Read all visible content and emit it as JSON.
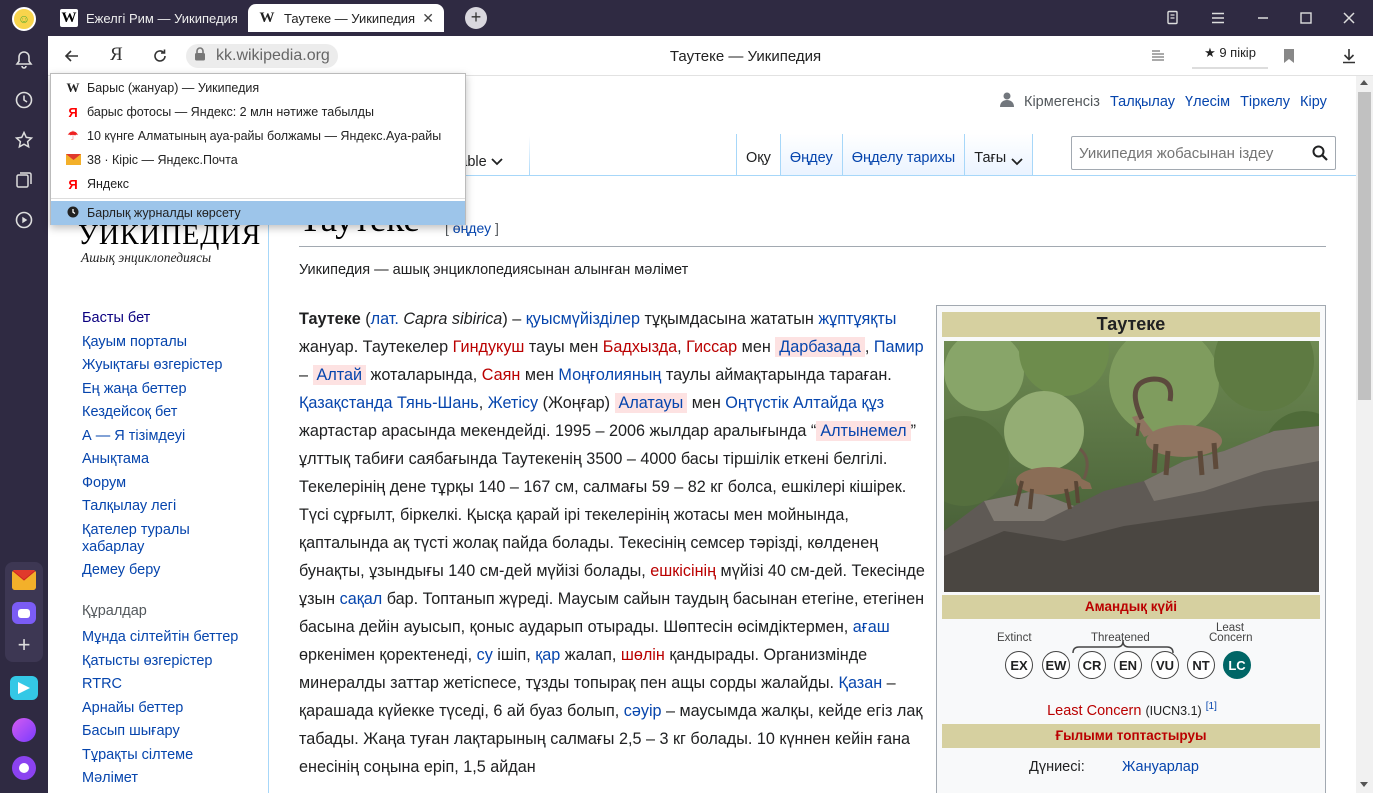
{
  "tabs": [
    {
      "title": "Ежелгі Рим — Уикипедия",
      "favicon": "W",
      "active": false
    },
    {
      "title": "Таутеке — Уикипедия",
      "favicon": "W",
      "active": true
    }
  ],
  "address": {
    "url": "kk.wikipedia.org",
    "page_title": "Таутеке — Уикипедия",
    "reviews": "9 пікір",
    "ya_letter": "Я"
  },
  "history_dropdown": {
    "items": [
      {
        "icon": "wikipedia-favicon",
        "glyph": "W",
        "label": "Барыс (жануар) — Уикипедия"
      },
      {
        "icon": "yandex-favicon",
        "glyph": "Я",
        "label": "барыс фотосы — Яндекс: 2 млн нәтиже табылды"
      },
      {
        "icon": "weather-umbrella-icon",
        "glyph": "☂",
        "label": "10 күнге Алматының ауа-райы болжамы — Яндекс.Ауа-райы"
      },
      {
        "icon": "mail-envelope-icon",
        "glyph": "✉",
        "label": "38 · Кіріс — Яндекс.Почта"
      },
      {
        "icon": "yandex-favicon",
        "glyph": "Я",
        "label": "Яндекс"
      }
    ],
    "show_all": "Барлық журналды көрсету"
  },
  "wiki": {
    "personal": [
      "Кірмегенсіз",
      "Талқылау",
      "Үлесім",
      "Тіркелу",
      "Кіру"
    ],
    "views": {
      "read": "Оқу",
      "edit": "Өңдеу",
      "history": "Өңделу тарихы",
      "more": "Тағы",
      "variant": "sable"
    },
    "search_placeholder": "Уикипедия жобасынан іздеу",
    "logo_title": "УИКИПЕДИЯ",
    "logo_sub": "Ашық энциклопедиясы",
    "nav": [
      "Басты бет",
      "Қауым порталы",
      "Жуықтағы өзгерістер",
      "Ең жаңа беттер",
      "Кездейсоқ бет",
      "А — Я тізімдеуі",
      "Анықтама",
      "Форум",
      "Талқылау легі",
      "Қателер туралы хабарлау",
      "Демеу беру"
    ],
    "tools_heading": "Құралдар",
    "tools": [
      "Мұнда сілтейтін беттер",
      "Қатысты өзгерістер",
      "RTRC",
      "Арнайы беттер",
      "Басып шығару",
      "Тұрақты сілтеме",
      "Мәлімет"
    ],
    "title": "Таутеке",
    "edit_link": "өңдеу",
    "tagline": "Уикипедия — ашық энциклопедиясынан алынған мәлімет"
  },
  "infobox": {
    "title": "Таутеке",
    "status_heading": "Амандық күйі",
    "iucn_codes": [
      "EX",
      "EW",
      "CR",
      "EN",
      "VU",
      "NT",
      "LC"
    ],
    "iucn_labels": {
      "extinct": "Extinct",
      "threatened": "Threatened",
      "lc1": "Least",
      "lc2": "Concern"
    },
    "status_text": "Least Concern",
    "status_source": "(IUCN3.1)",
    "ref": "[1]",
    "taxonomy_heading": "Ғылыми топтастыруы",
    "kingdom_label": "Дүниесі:",
    "kingdom_value": "Жануарлар",
    "colors": {
      "header_bg": "#d6d0a0",
      "lc_color": "#006666",
      "status_red": "#ba0000"
    }
  },
  "colors": {
    "chrome_dark": "#2f2a42",
    "link": "#0645ad",
    "redlink": "#ba0000",
    "highlight": "#fde2e2",
    "dropdown_selected": "#9dc5ea"
  }
}
